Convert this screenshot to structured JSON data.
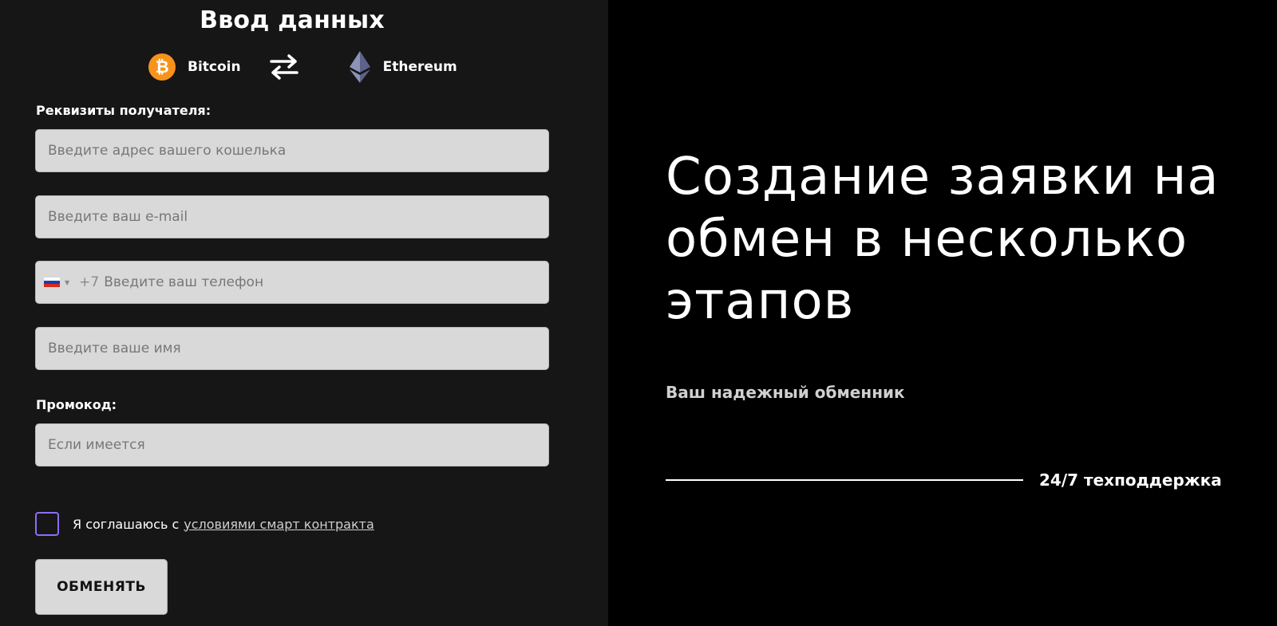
{
  "form": {
    "title": "Ввод данных",
    "from_coin": {
      "label": "Bitcoin",
      "icon": "bitcoin-icon",
      "color": "#f7931a"
    },
    "to_coin": {
      "label": "Ethereum",
      "icon": "ethereum-icon"
    },
    "recipient_label": "Реквизиты получателя:",
    "wallet_placeholder": "Введите адрес вашего кошелька",
    "email_placeholder": "Введите ваш e-mail",
    "phone_code": "+7",
    "phone_placeholder": "Введите ваш телефон",
    "name_placeholder": "Введите ваше имя",
    "promo_label": "Промокод:",
    "promo_placeholder": "Если имеется",
    "agree_text": "Я соглашаюсь с",
    "agree_link": "условиями смарт контракта",
    "submit_label": "ОБМЕНЯТЬ"
  },
  "hero": {
    "heading": "Создание заявки на обмен в несколько этапов",
    "tagline": "Ваш надежный обменник",
    "support": "24/7 техподдержка"
  },
  "colors": {
    "left_bg": "#161616",
    "right_bg": "#000000",
    "field_bg": "#d9d9d9",
    "checkbox_border": "#8f6cff"
  }
}
